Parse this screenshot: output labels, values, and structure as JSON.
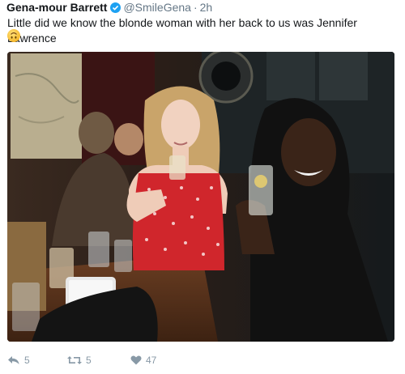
{
  "tweet": {
    "display_name": "Gena-mour Barrett",
    "handle": "@SmileGena",
    "separator": "·",
    "time": "2h",
    "text": "Little did we know the blonde woman with her back to us was Jennifer Lawrence",
    "emoji": "upside-down-face-emoji"
  },
  "photo": {
    "icon": "photo-image"
  },
  "actions": {
    "replies": "5",
    "retweets": "5",
    "likes": "47"
  },
  "colors": {
    "verified": "#1da1f2",
    "action_gray": "#8899a6",
    "handle_gray": "#657786"
  }
}
